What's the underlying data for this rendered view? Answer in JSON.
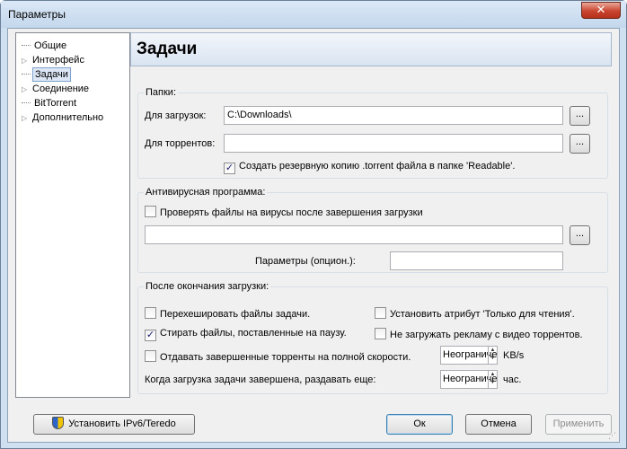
{
  "window": {
    "title": "Параметры",
    "close_glyph": "✕"
  },
  "tree": {
    "items": [
      {
        "label": "Общие",
        "expandable": false
      },
      {
        "label": "Интерфейс",
        "expandable": true
      },
      {
        "label": "Задачи",
        "expandable": false,
        "selected": true
      },
      {
        "label": "Соединение",
        "expandable": true
      },
      {
        "label": "BitTorrent",
        "expandable": false
      },
      {
        "label": "Дополнительно",
        "expandable": true
      }
    ]
  },
  "page": {
    "title": "Задачи"
  },
  "folders": {
    "title": "Папки:",
    "download_label": "Для загрузок:",
    "download_value": "C:\\Downloads\\",
    "torrent_label": "Для торрентов:",
    "torrent_value": "",
    "browse": "...",
    "backup_label": "Создать резервную копию .torrent файла в папке 'Readable'.",
    "backup_checked": true
  },
  "antivirus": {
    "title": "Антивирусная программа:",
    "scan_label": "Проверять файлы на вирусы после завершения загрузки",
    "scan_checked": false,
    "path_value": "",
    "params_label": "Параметры (опцион.):",
    "params_value": ""
  },
  "after": {
    "title": "После окончания загрузки:",
    "rehash_label": "Перехешировать файлы задачи.",
    "rehash_checked": false,
    "erase_paused_label": "Стирать файлы, поставленные на паузу.",
    "erase_paused_checked": true,
    "readonly_label": "Установить атрибут 'Только для чтения'.",
    "readonly_checked": false,
    "no_ads_label": "Не загружать рекламу с видео торрентов.",
    "no_ads_checked": false,
    "fullspeed_label": "Отдавать завершенные торренты на полной скорости.",
    "fullspeed_checked": false,
    "fullspeed_value": "Неограниче",
    "fullspeed_unit": "KB/s",
    "seed_label": "Когда загрузка задачи завершена, раздавать еще:",
    "seed_value": "Неограниче",
    "seed_unit": "час."
  },
  "buttons": {
    "ipv6": "Установить IPv6/Teredo",
    "ok": "Ок",
    "cancel": "Отмена",
    "apply": "Применить"
  },
  "glyphs": {
    "check": "✓",
    "tree_expand": "▷",
    "spin_up": "▲",
    "spin_down": "▼"
  }
}
